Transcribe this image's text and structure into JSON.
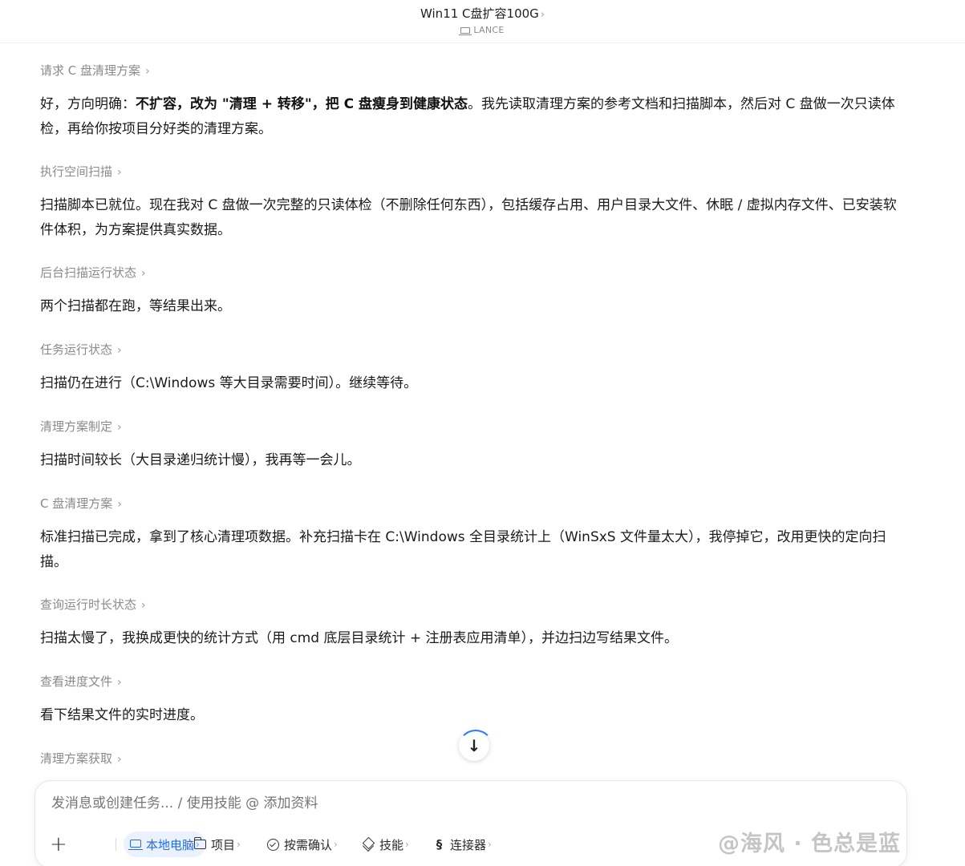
{
  "header": {
    "title": "Win11 C盘扩容100G",
    "title_chevron": "›",
    "device_label": "LANCE"
  },
  "steps": [
    {
      "label": "请求 C 盘清理方案"
    },
    {
      "label": "执行空间扫描"
    },
    {
      "label": "后台扫描运行状态"
    },
    {
      "label": "任务运行状态"
    },
    {
      "label": "清理方案制定"
    },
    {
      "label": "C 盘清理方案"
    },
    {
      "label": "查询运行时长状态"
    },
    {
      "label": "查看进度文件"
    },
    {
      "label": "清理方案获取"
    }
  ],
  "messages": [
    {
      "pre": "好，方向明确：",
      "bold": "不扩容，改为 \"清理 + 转移\"，把 C 盘瘦身到健康状态",
      "post": "。我先读取清理方案的参考文档和扫描脚本，然后对 C 盘做一次只读体检，再给你按项目分好类的清理方案。"
    },
    {
      "text": "扫描脚本已就位。现在我对 C 盘做一次完整的只读体检（不删除任何东西），包括缓存占用、用户目录大文件、休眠 / 虚拟内存文件、已安装软件体积，为方案提供真实数据。"
    },
    {
      "text": "两个扫描都在跑，等结果出来。"
    },
    {
      "text": "扫描仍在进行（C:\\Windows 等大目录需要时间）。继续等待。"
    },
    {
      "text": "扫描时间较长（大目录递归统计慢），我再等一会儿。"
    },
    {
      "text": "标准扫描已完成，拿到了核心清理项数据。补充扫描卡在 C:\\Windows 全目录统计上（WinSxS 文件量太大），我停掉它，改用更快的定向扫描。"
    },
    {
      "text": "扫描太慢了，我换成更快的统计方式（用 cmd 底层目录统计 + 注册表应用清单），并边扫边写结果文件。"
    },
    {
      "text": "看下结果文件的实时进度。"
    }
  ],
  "chevron": "›",
  "scroll_button": {
    "icon": "arrow-down-icon",
    "glyph": "↓"
  },
  "composer": {
    "placeholder": "发消息或创建任务... / 使用技能 @ 添加资料",
    "plus": "+",
    "toolbar": {
      "local": "本地电脑",
      "project": "项目",
      "confirm": "按需确认",
      "skills": "技能",
      "connectors": "连接器"
    }
  },
  "watermark": "@海风 · 色总是蓝",
  "colors": {
    "accent": "#1f6bf0",
    "accent_bg": "#eaf2ff",
    "muted": "#8a8a8a"
  }
}
